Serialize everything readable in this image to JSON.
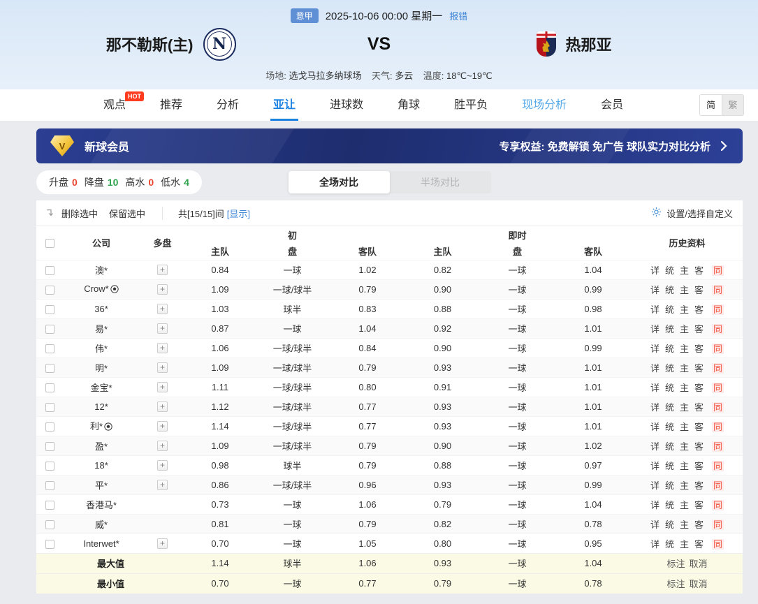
{
  "colors": {
    "accent_blue": "#1b82e2",
    "link_blue": "#3f86d6",
    "rise_red": "#e8442e",
    "drop_green": "#2fa24c",
    "banner_navy": "#1e2d6e",
    "gold": "#f3c43a",
    "same_red": "#f0533c",
    "summary_bg": "#fbfae4"
  },
  "header": {
    "league_badge": "意甲",
    "datetime": "2025-10-06 00:00 星期一",
    "report_error": "报错",
    "home_team": "那不勒斯(主)",
    "home_logo_letter": "N",
    "vs": "VS",
    "away_team": "热那亚",
    "venue_label": "场地:",
    "venue": "选戈马拉多纳球场",
    "weather_label": "天气:",
    "weather": "多云",
    "temp_label": "温度:",
    "temp": "18℃~19℃"
  },
  "nav": {
    "tabs": [
      {
        "key": "viewpoints",
        "label": "观点",
        "badge": "HOT"
      },
      {
        "key": "recommend",
        "label": "推荐"
      },
      {
        "key": "analysis",
        "label": "分析"
      },
      {
        "key": "asian-handicap",
        "label": "亚让",
        "active": true
      },
      {
        "key": "goals",
        "label": "进球数"
      },
      {
        "key": "corners",
        "label": "角球"
      },
      {
        "key": "win-draw-lose",
        "label": "胜平负"
      },
      {
        "key": "live-analysis",
        "label": "现场分析",
        "highlight": true
      },
      {
        "key": "member",
        "label": "会员"
      }
    ],
    "lang_simplified": "简",
    "lang_traditional": "繁"
  },
  "banner": {
    "diamond_letter": "V",
    "title": "新球会员",
    "benefits": "专享权益: 免费解锁 免广告 球队实力对比分析"
  },
  "filters": {
    "items": [
      {
        "key": "rise",
        "label": "升盘",
        "value": "0",
        "color": "red"
      },
      {
        "key": "drop",
        "label": "降盘",
        "value": "10",
        "color": "green"
      },
      {
        "key": "high-water",
        "label": "高水",
        "value": "0",
        "color": "red"
      },
      {
        "key": "low-water",
        "label": "低水",
        "value": "4",
        "color": "green"
      }
    ],
    "toggle": {
      "full": "全场对比",
      "half": "半场对比"
    }
  },
  "controls": {
    "delete_selected": "删除选中",
    "keep_selected": "保留选中",
    "count_text": "共[15/15]间",
    "show_link": "[显示]",
    "settings": "设置/选择自定义"
  },
  "table": {
    "headers": {
      "company": "公司",
      "multi": "多盘",
      "initial": "初",
      "live": "即时",
      "pan": "盘",
      "home": "主队",
      "away": "客队",
      "history": "历史资料"
    },
    "multi_icon": "+",
    "history_links": [
      "详",
      "统",
      "主",
      "客",
      "同"
    ],
    "history_keys": [
      "detail",
      "stats",
      "home",
      "away",
      "same"
    ],
    "rows": [
      {
        "company": "澳*",
        "ball": false,
        "multi": true,
        "init": [
          "0.84",
          "一球",
          "1.02"
        ],
        "live": [
          "0.82",
          "一球",
          "1.04"
        ]
      },
      {
        "company": "Crow*",
        "ball": true,
        "multi": true,
        "init": [
          "1.09",
          "一球/球半",
          "0.79"
        ],
        "live": [
          "0.90",
          "一球",
          "0.99"
        ]
      },
      {
        "company": "36*",
        "ball": false,
        "multi": true,
        "init": [
          "1.03",
          "球半",
          "0.83"
        ],
        "live": [
          "0.88",
          "一球",
          "0.98"
        ]
      },
      {
        "company": "易*",
        "ball": false,
        "multi": true,
        "init": [
          "0.87",
          "一球",
          "1.04"
        ],
        "live": [
          "0.92",
          "一球",
          "1.01"
        ]
      },
      {
        "company": "伟*",
        "ball": false,
        "multi": true,
        "init": [
          "1.06",
          "一球/球半",
          "0.84"
        ],
        "live": [
          "0.90",
          "一球",
          "0.99"
        ]
      },
      {
        "company": "明*",
        "ball": false,
        "multi": true,
        "init": [
          "1.09",
          "一球/球半",
          "0.79"
        ],
        "live": [
          "0.93",
          "一球",
          "1.01"
        ]
      },
      {
        "company": "金宝*",
        "ball": false,
        "multi": true,
        "init": [
          "1.11",
          "一球/球半",
          "0.80"
        ],
        "live": [
          "0.91",
          "一球",
          "1.01"
        ]
      },
      {
        "company": "12*",
        "ball": false,
        "multi": true,
        "init": [
          "1.12",
          "一球/球半",
          "0.77"
        ],
        "live": [
          "0.93",
          "一球",
          "1.01"
        ]
      },
      {
        "company": "利*",
        "ball": true,
        "multi": true,
        "init": [
          "1.14",
          "一球/球半",
          "0.77"
        ],
        "live": [
          "0.93",
          "一球",
          "1.01"
        ]
      },
      {
        "company": "盈*",
        "ball": false,
        "multi": true,
        "init": [
          "1.09",
          "一球/球半",
          "0.79"
        ],
        "live": [
          "0.90",
          "一球",
          "1.02"
        ]
      },
      {
        "company": "18*",
        "ball": false,
        "multi": true,
        "init": [
          "0.98",
          "球半",
          "0.79"
        ],
        "live": [
          "0.88",
          "一球",
          "0.97"
        ]
      },
      {
        "company": "平*",
        "ball": false,
        "multi": true,
        "init": [
          "0.86",
          "一球/球半",
          "0.96"
        ],
        "live": [
          "0.93",
          "一球",
          "0.99"
        ]
      },
      {
        "company": "香港马*",
        "ball": false,
        "multi": false,
        "init": [
          "0.73",
          "一球",
          "1.06"
        ],
        "live": [
          "0.79",
          "一球",
          "1.04"
        ]
      },
      {
        "company": "威*",
        "ball": false,
        "multi": false,
        "init": [
          "0.81",
          "一球",
          "0.79"
        ],
        "live": [
          "0.82",
          "一球",
          "0.78"
        ]
      },
      {
        "company": "Interwet*",
        "ball": false,
        "multi": true,
        "init": [
          "0.70",
          "一球",
          "1.05"
        ],
        "live": [
          "0.80",
          "一球",
          "0.95"
        ]
      }
    ],
    "summary": [
      {
        "label": "最大值",
        "init": [
          "1.14",
          "球半",
          "1.06"
        ],
        "live": [
          "0.93",
          "一球",
          "1.04"
        ],
        "actions": [
          "标注",
          "取消"
        ]
      },
      {
        "label": "最小值",
        "init": [
          "0.70",
          "一球",
          "0.77"
        ],
        "live": [
          "0.79",
          "一球",
          "0.78"
        ],
        "actions": [
          "标注",
          "取消"
        ]
      }
    ]
  }
}
